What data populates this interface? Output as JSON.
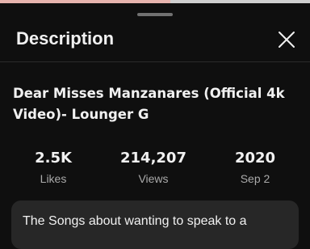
{
  "panel": {
    "title": "Description"
  },
  "video": {
    "title": "Dear Misses Manzanares (Official 4k Video)- Lounger G"
  },
  "stats": {
    "likes": {
      "value": "2.5K",
      "label": "Likes"
    },
    "views": {
      "value": "214,207",
      "label": "Views"
    },
    "date": {
      "year": "2020",
      "day": "Sep 2"
    }
  },
  "description": {
    "text": "The Songs about wanting to speak to a"
  },
  "icons": {
    "close": "close-icon"
  },
  "colors": {
    "background": "#0f0f0f",
    "text_primary": "#f1f1f1",
    "text_secondary": "#aaaaaa",
    "description_bg": "#272727"
  }
}
